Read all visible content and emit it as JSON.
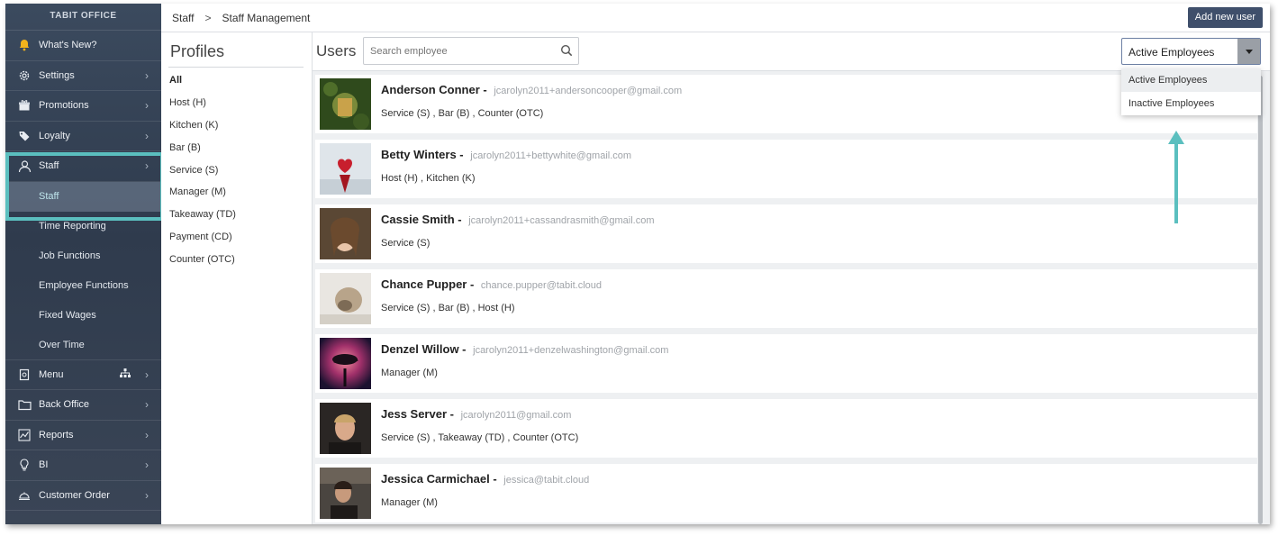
{
  "sidebar": {
    "brand": "TABIT OFFICE",
    "items_top": [
      {
        "label": "What's New?",
        "icon": "bell-icon",
        "chevron": false
      },
      {
        "label": "Settings",
        "icon": "gear-icon",
        "chevron": true
      },
      {
        "label": "Promotions",
        "icon": "gift-icon",
        "chevron": true
      },
      {
        "label": "Loyalty",
        "icon": "tag-icon",
        "chevron": true
      },
      {
        "label": "Staff",
        "icon": "user-icon",
        "chevron": true
      }
    ],
    "staff_sub": [
      "Staff",
      "Time Reporting",
      "Job Functions",
      "Employee Functions",
      "Fixed Wages",
      "Over Time"
    ],
    "items_bottom": [
      {
        "label": "Menu",
        "icon": "menu-book-icon"
      },
      {
        "label": "Back Office",
        "icon": "folder-icon"
      },
      {
        "label": "Reports",
        "icon": "chart-icon"
      },
      {
        "label": "BI",
        "icon": "lightbulb-icon"
      },
      {
        "label": "Customer Order",
        "icon": "cloche-icon"
      }
    ]
  },
  "breadcrumb": {
    "first": "Staff",
    "separator": ">",
    "second": "Staff Management"
  },
  "add_user_label": "Add new user",
  "profiles": {
    "title": "Profiles",
    "items": [
      "All",
      "Host (H)",
      "Kitchen (K)",
      "Bar (B)",
      "Service (S)",
      "Manager (M)",
      "Takeaway (TD)",
      "Payment (CD)",
      "Counter (OTC)"
    ]
  },
  "users": {
    "title": "Users",
    "search_placeholder": "Search employee",
    "filter_value": "Active Employees",
    "filter_options": [
      "Active Employees",
      "Inactive Employees"
    ],
    "rows": [
      {
        "name": "Anderson Conner",
        "email": "jcarolyn2011+andersoncooper@gmail.com",
        "roles": "Service (S) , Bar (B) , Counter (OTC)"
      },
      {
        "name": "Betty Winters",
        "email": "jcarolyn2011+bettywhite@gmail.com",
        "roles": "Host (H) , Kitchen (K)"
      },
      {
        "name": "Cassie Smith",
        "email": "jcarolyn2011+cassandrasmith@gmail.com",
        "roles": "Service (S)"
      },
      {
        "name": "Chance Pupper",
        "email": "chance.pupper@tabit.cloud",
        "roles": "Service (S) , Bar (B) , Host (H)"
      },
      {
        "name": "Denzel Willow",
        "email": "jcarolyn2011+denzelwashington@gmail.com",
        "roles": "Manager (M)"
      },
      {
        "name": "Jess Server",
        "email": "jcarolyn2011@gmail.com",
        "roles": "Service (S) , Takeaway (TD) , Counter (OTC)"
      },
      {
        "name": "Jessica Carmichael",
        "email": "jessica@tabit.cloud",
        "roles": "Manager (M)"
      }
    ]
  },
  "colors": {
    "sidebar": "#33404f",
    "highlight": "#5bbfbf",
    "button": "#3f4f6b"
  }
}
